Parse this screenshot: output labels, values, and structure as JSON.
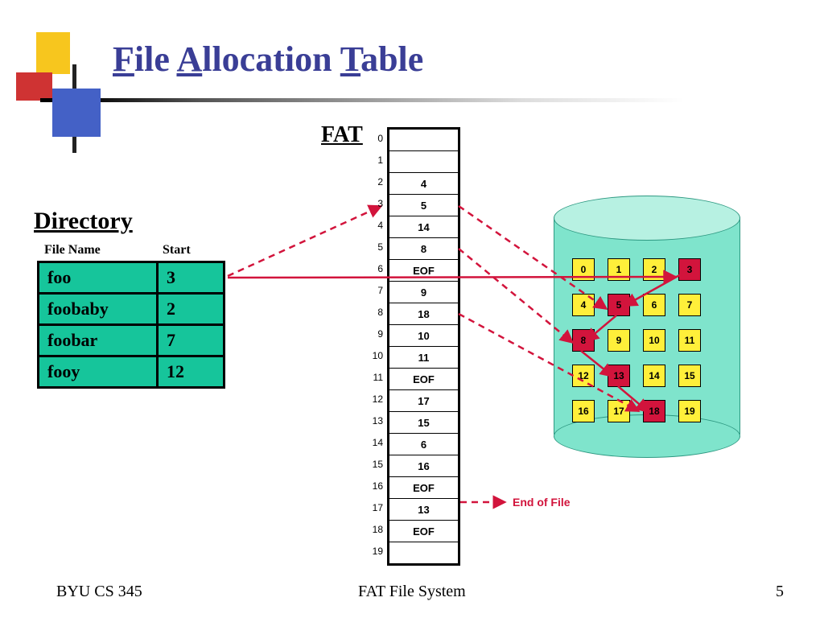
{
  "title": {
    "word1": "File",
    "word2": "Allocation",
    "word3": "Table",
    "u1": "F",
    "u2": "A",
    "u3": "T"
  },
  "sections": {
    "directory": "Directory",
    "fat": "FAT"
  },
  "dir": {
    "headers": {
      "name": "File Name",
      "start": "Start"
    },
    "rows": [
      {
        "name": "foo",
        "start": "3"
      },
      {
        "name": "foobaby",
        "start": "2"
      },
      {
        "name": "foobar",
        "start": "7"
      },
      {
        "name": "fooy",
        "start": "12"
      }
    ]
  },
  "fat": {
    "entries": [
      "",
      "",
      "4",
      "5",
      "14",
      "8",
      "EOF",
      "9",
      "18",
      "10",
      "11",
      "EOF",
      "17",
      "15",
      "6",
      "16",
      "EOF",
      "13",
      "EOF",
      ""
    ]
  },
  "disk": {
    "cells": [
      "0",
      "1",
      "2",
      "3",
      "4",
      "5",
      "6",
      "7",
      "8",
      "9",
      "10",
      "11",
      "12",
      "13",
      "14",
      "15",
      "16",
      "17",
      "18",
      "19"
    ],
    "red": [
      3,
      5,
      8,
      13,
      18
    ]
  },
  "eof_label": "End of File",
  "footer": {
    "left": "BYU CS 345",
    "center": "FAT File System",
    "right": "5"
  }
}
